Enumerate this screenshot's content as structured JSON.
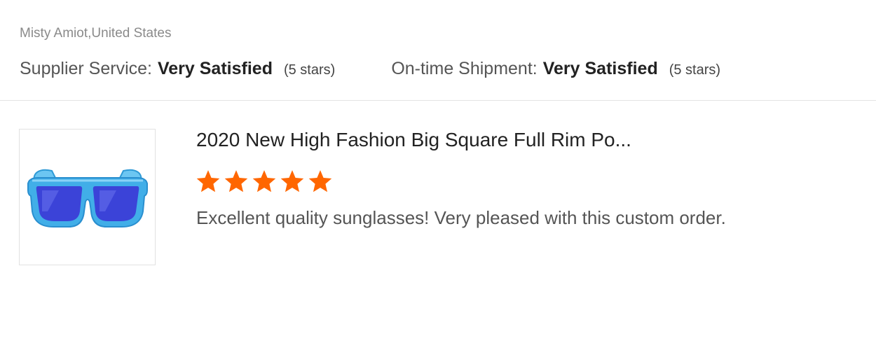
{
  "reviewer": {
    "name_location": "Misty Amiot,United States"
  },
  "ratings": [
    {
      "label": "Supplier Service:",
      "value": "Very Satisfied",
      "stars_text": "(5 stars)"
    },
    {
      "label": "On-time Shipment:",
      "value": "Very Satisfied",
      "stars_text": "(5 stars)"
    }
  ],
  "product": {
    "title": "2020 New High Fashion Big Square Full Rim Po...",
    "rating": 5,
    "rating_max": 5,
    "image_icon": "blue-sunglasses-icon"
  },
  "review": {
    "comment": "Excellent quality sunglasses!  Very pleased with this custom order."
  },
  "colors": {
    "star": "#ff6600",
    "divider": "#e3e3e3",
    "frame": "#41aee8",
    "lens": "#3b43d8"
  }
}
